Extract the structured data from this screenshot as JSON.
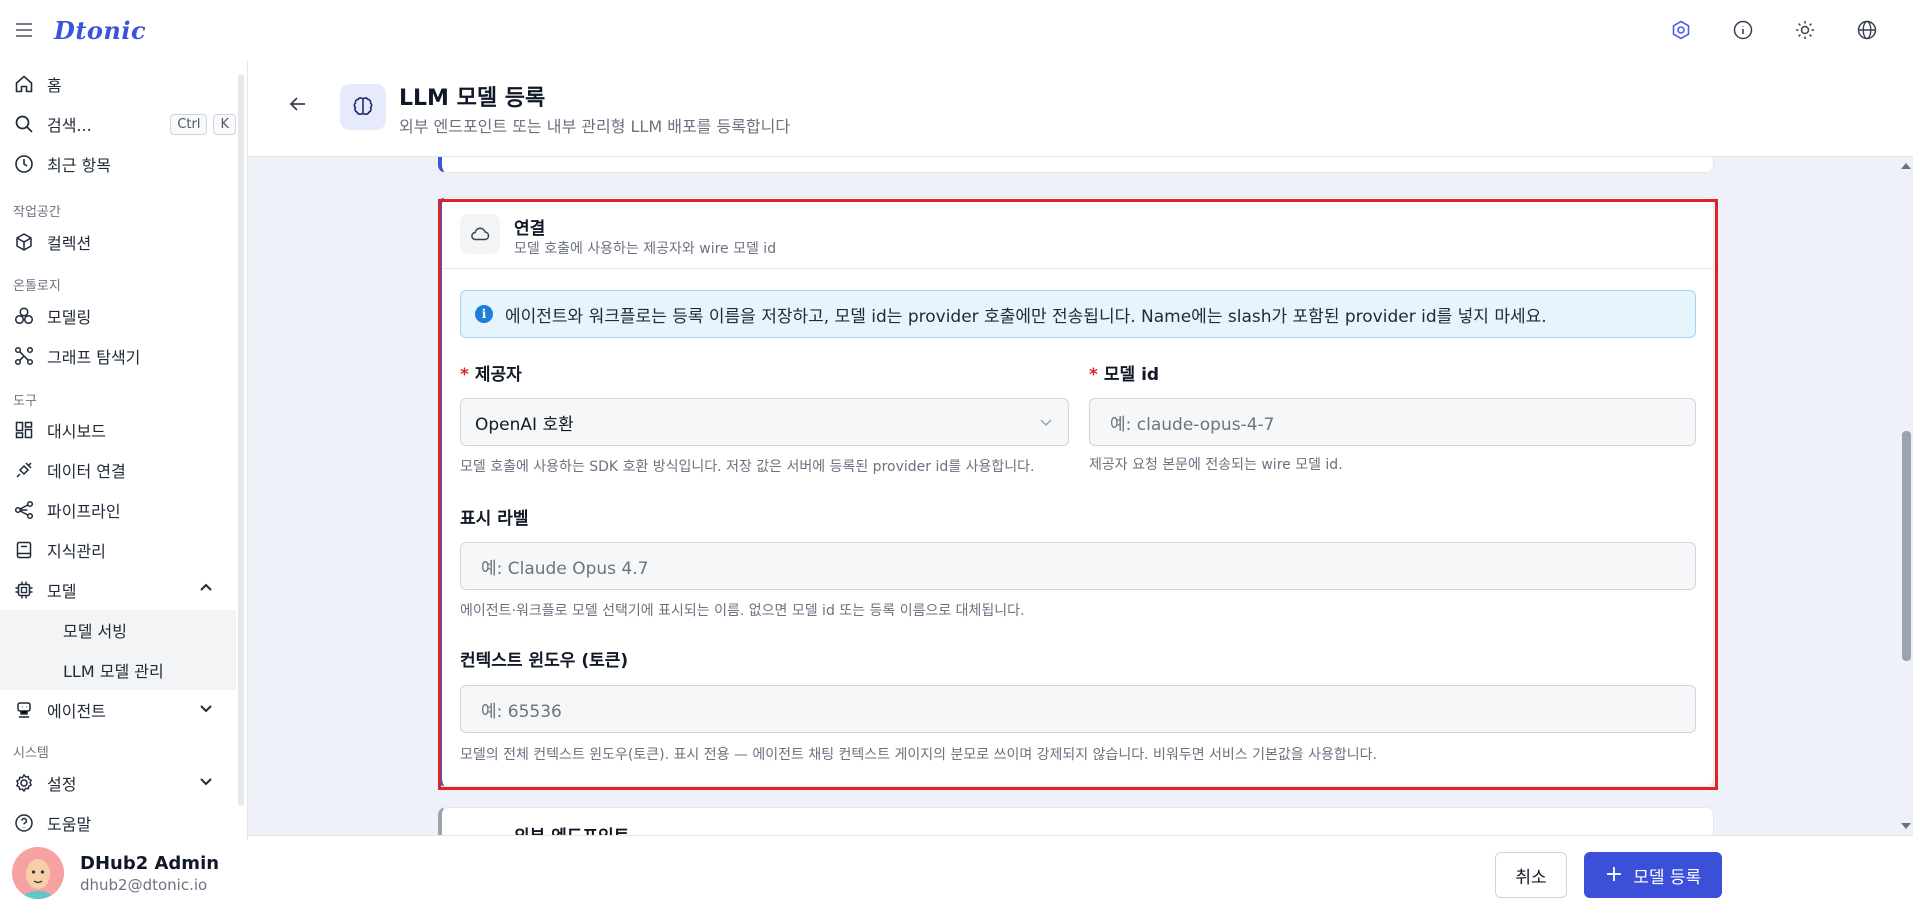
{
  "app": {
    "logo": "Dtonic"
  },
  "sidebar": {
    "home": "홈",
    "search": "검색...",
    "kbd_ctrl": "Ctrl",
    "kbd_k": "K",
    "recent": "최근 항목",
    "section_workspace": "작업공간",
    "collection": "컬렉션",
    "section_ontology": "온톨로지",
    "modeling": "모델링",
    "graph_explorer": "그래프 탐색기",
    "section_tools": "도구",
    "dashboard": "대시보드",
    "data_connection": "데이터 연결",
    "pipeline": "파이프라인",
    "knowledge": "지식관리",
    "models": "모델",
    "model_serving": "모델 서빙",
    "llm_management": "LLM 모델 관리",
    "agent": "에이전트",
    "section_system": "시스템",
    "settings": "설정",
    "help": "도움말"
  },
  "user": {
    "name": "DHub2 Admin",
    "email": "dhub2@dtonic.io"
  },
  "header": {
    "title": "LLM 모델 등록",
    "subtitle": "외부 엔드포인트 또는 내부 관리형 LLM 배포를 등록합니다"
  },
  "connection": {
    "title": "연결",
    "subtitle": "모델 호출에 사용하는 제공자와 wire 모델 id",
    "info": "에이전트와 워크플로는 등록 이름을 저장하고, 모델 id는 provider 호출에만 전송됩니다. Name에는 slash가 포함된 provider id를 넣지 마세요.",
    "provider_label": "제공자",
    "provider_value": "OpenAI 호환",
    "provider_help": "모델 호출에 사용하는 SDK 호환 방식입니다. 저장 값은 서버에 등록된 provider id를 사용합니다.",
    "model_id_label": "모델 id",
    "model_id_placeholder": "예: claude-opus-4-7",
    "model_id_help": "제공자 요청 본문에 전송되는 wire 모델 id.",
    "display_label": "표시 라벨",
    "display_placeholder": "예: Claude Opus 4.7",
    "display_help": "에이전트·워크플로 모델 선택기에 표시되는 이름. 없으면 모델 id 또는 등록 이름으로 대체됩니다.",
    "context_label": "컨텍스트 윈도우 (토큰)",
    "context_placeholder": "예: 65536",
    "context_help": "모델의 전체 컨텍스트 윈도우(토큰). 표시 전용 — 에이전트 채팅 컨텍스트 게이지의 분모로 쓰이며 강제되지 않습니다. 비워두면 서비스 기본값을 사용합니다.",
    "required_mark": "*"
  },
  "next_section": {
    "title": "외부 엔드포인트"
  },
  "footer": {
    "cancel": "취소",
    "submit": "모델 등록",
    "submit_icon": "+"
  },
  "colors": {
    "accent": "#3b4fd8",
    "highlight": "#dc2626",
    "info_bg": "#e6f4fd"
  }
}
